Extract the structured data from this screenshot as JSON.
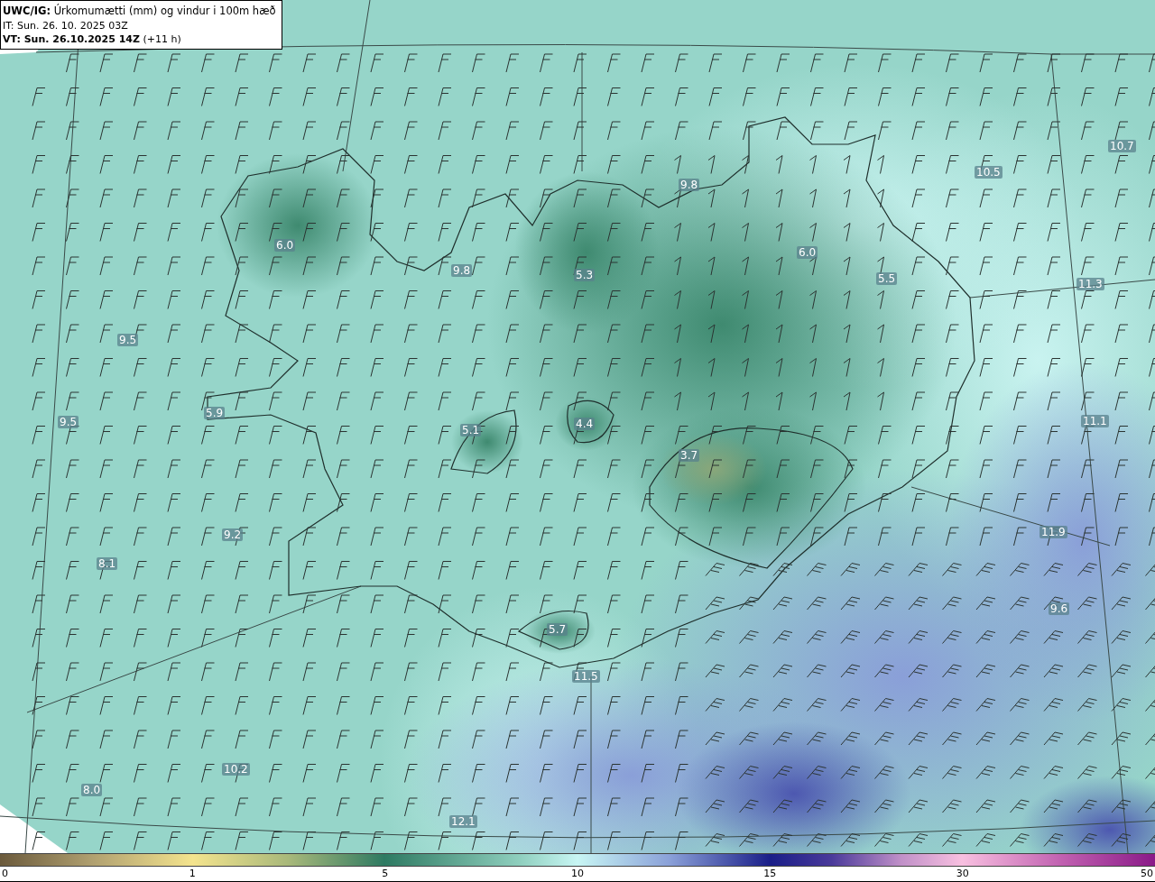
{
  "header": {
    "title": "**UWC/IG:** Úrkomumætti (mm) og vindur i 100m hæð",
    "issue_time": "IT: Sun. 26. 10. 2025 03Z",
    "valid_time": "**VT: Sun. 26.10.2025 14Z** (+11 h)"
  },
  "map": {
    "value_labels": [
      {
        "text": "10.7"
      },
      {
        "text": "10.5"
      },
      {
        "text": "9.8"
      },
      {
        "text": "6.0"
      },
      {
        "text": "6.0"
      },
      {
        "text": "9.8"
      },
      {
        "text": "5.3"
      },
      {
        "text": "5.5"
      },
      {
        "text": "11.3"
      },
      {
        "text": "9.5"
      },
      {
        "text": "5.9"
      },
      {
        "text": "9.5"
      },
      {
        "text": "4.4"
      },
      {
        "text": "5.1"
      },
      {
        "text": "11.1"
      },
      {
        "text": "3.7"
      },
      {
        "text": "11.9"
      },
      {
        "text": "9.2"
      },
      {
        "text": "8.1"
      },
      {
        "text": "9.6"
      },
      {
        "text": "5.7"
      },
      {
        "text": "11.5"
      },
      {
        "text": "10.2"
      },
      {
        "text": "8.0"
      },
      {
        "text": "12.1"
      }
    ]
  },
  "colorbar": {
    "ticks": [
      "0",
      "1",
      "5",
      "10",
      "15",
      "30",
      "50"
    ]
  }
}
